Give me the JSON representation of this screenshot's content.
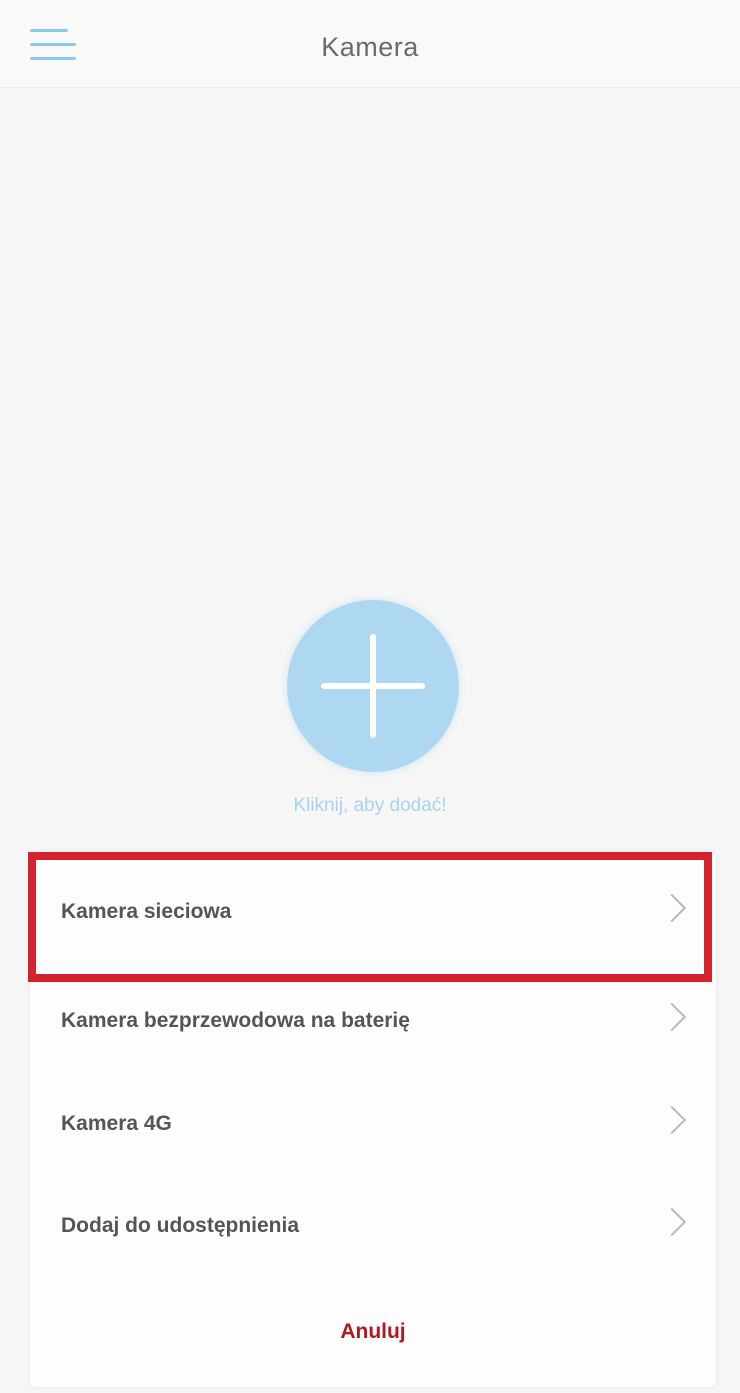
{
  "header": {
    "title": "Kamera",
    "menu_icon": "hamburger-menu-icon"
  },
  "add_device": {
    "icon": "plus-icon",
    "hint": "Kliknij, aby dodać!"
  },
  "sheet": {
    "options": [
      {
        "label": "Kamera sieciowa",
        "highlighted": true
      },
      {
        "label": "Kamera bezprzewodowa na baterię",
        "highlighted": false
      },
      {
        "label": "Kamera 4G",
        "highlighted": false
      },
      {
        "label": "Dodaj do udostępnienia",
        "highlighted": false
      }
    ],
    "cancel_label": "Anuluj"
  },
  "colors": {
    "accent": "#aed8f2",
    "hint_text": "#a8d4ee",
    "cancel": "#b0191f",
    "highlight_border": "#d4222e"
  }
}
